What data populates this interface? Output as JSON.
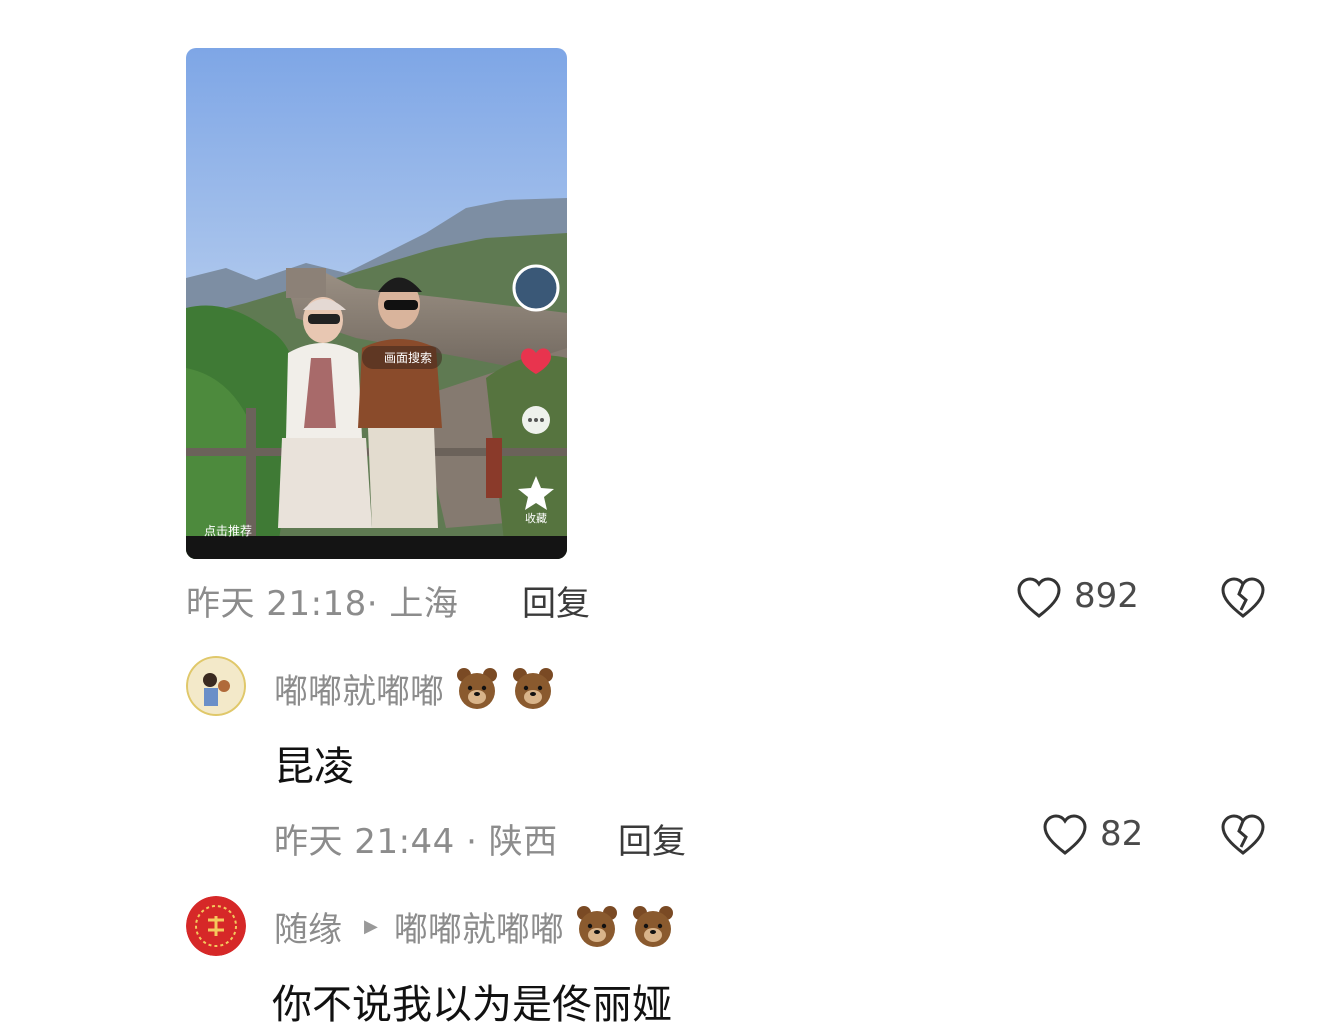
{
  "video": {
    "promo_chip": "画面搜索",
    "like_chip": "点击推荐",
    "heart_count": "",
    "collect_label": "收藏"
  },
  "comment1": {
    "meta": "昨天 21:18· 上海",
    "reply_label": "回复",
    "likes": "892"
  },
  "comment2": {
    "username": "嘟嘟就嘟嘟",
    "emoji_icon": "bear-face",
    "text": "昆凌",
    "meta": "昨天 21:44 · 陕西",
    "reply_label": "回复",
    "likes": "82"
  },
  "comment3": {
    "username": "随缘",
    "reply_to": "嘟嘟就嘟嘟",
    "emoji_icon": "bear-face",
    "text": "你不说我以为是佟丽娅"
  },
  "colors": {
    "meta_gray": "#8c8c8c",
    "text_dark": "#111111",
    "sky_blue": "#8fb3e8"
  }
}
